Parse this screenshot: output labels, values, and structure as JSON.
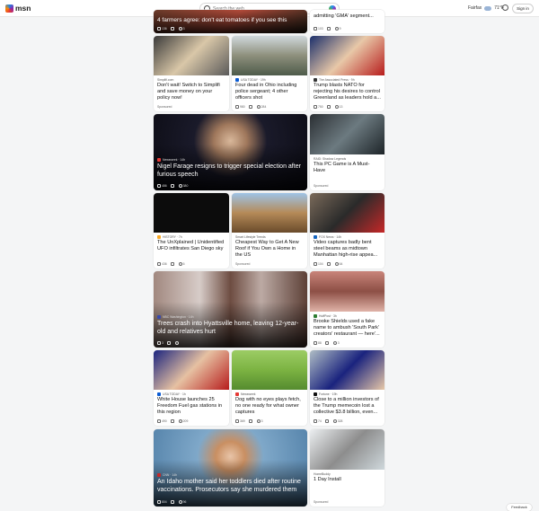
{
  "header": {
    "logo": "msn",
    "search_placeholder": "Search the web",
    "location": "Fairfax",
    "temperature": "71°F",
    "signin": "Sign in"
  },
  "cards": [
    {
      "id": "c0",
      "title": "4 farmers agree: don't eat tomatoes if you see this",
      "source": "",
      "stats": {
        "likes": "136",
        "comments": "3"
      },
      "type": "overlay"
    },
    {
      "id": "c1",
      "title": "admitting 'GMA' segment...",
      "source": "",
      "stats": {
        "likes": "103",
        "comments": "9"
      }
    },
    {
      "id": "c2",
      "title": "Don't wait! Switch to Simplifi and save money on your policy now!",
      "source": "Simplifi.com",
      "sponsored": "Sponsored"
    },
    {
      "id": "c3",
      "title": "Four dead in Ohio including police sergeant; 4 other officers shot",
      "source": "USA TODAY · 19h",
      "stats": {
        "likes": "980",
        "comments": "284"
      }
    },
    {
      "id": "c4",
      "title": "Trump blasts NATO for rejecting his desires to control Greenland as leaders hold a...",
      "source": "The Associated Press · 9h",
      "stats": {
        "likes": "750",
        "comments": "13"
      }
    },
    {
      "id": "c5",
      "title": "Nigel Farage resigns to trigger special election after furious speech",
      "source": "Newsweek · 14h",
      "stats": {
        "likes": "486",
        "comments": "380"
      },
      "type": "overlay"
    },
    {
      "id": "c6",
      "title": "This PC Game is A Must-Have",
      "source": "RAID: Shadow Legends",
      "sponsored": "Sponsored"
    },
    {
      "id": "c7",
      "title": "The UnXplained | Unidentified UFO infiltrates San Diego sky",
      "source": "HISTORY · 7h",
      "stats": {
        "likes": "436",
        "comments": "6"
      }
    },
    {
      "id": "c8",
      "title": "Cheapest Way to Get A New Roof if You Own a Home in the US",
      "source": "Smart Lifestyle Trends",
      "sponsored": "Sponsored"
    },
    {
      "id": "c9",
      "title": "Video captures badly bent steel beams as midtown Manhattan high-rise appea...",
      "source": "FOX News · 14h",
      "stats": {
        "likes": "104",
        "comments": "64"
      }
    },
    {
      "id": "c10",
      "title": "Trees crash into Hyattsville home, leaving 12-year-old and relatives hurt",
      "source": "NBC Washington · 14h",
      "stats": {
        "likes": "3",
        "comments": ""
      },
      "type": "overlay"
    },
    {
      "id": "c11",
      "title": "Brooke Shields used a fake name to ambush 'South Park' creators' restaurant — here'...",
      "source": "HuffPost · 3h",
      "stats": {
        "likes": "88",
        "comments": "3"
      }
    },
    {
      "id": "c12",
      "title": "White House launches 25 Freedom Fuel gas stations in this region",
      "source": "USA TODAY · 1h",
      "stats": {
        "likes": "490",
        "comments": "209"
      }
    },
    {
      "id": "c13",
      "title": "Dog with no eyes plays fetch, no one ready for what owner captures",
      "source": "Newsweek",
      "stats": {
        "likes": "369",
        "comments": "3"
      }
    },
    {
      "id": "c14",
      "title": "Close to a million investors of the Trump memecoin lost a collective $3.8 billion, even...",
      "source": "Fortune · 19h",
      "stats": {
        "likes": "74",
        "comments": "328"
      }
    },
    {
      "id": "c15",
      "title": "An Idaho mother said her toddlers died after routine vaccinations. Prosecutors say she murdered them",
      "source": "CNN · 14h",
      "stats": {
        "likes": "804",
        "comments": "96"
      },
      "type": "overlay"
    },
    {
      "id": "c16",
      "title": "1 Day Install",
      "source": "HomeBuddy",
      "sponsored": "Sponsored"
    }
  ],
  "feedback": "Feedback",
  "colors": {
    "accent": "#0067b8"
  }
}
